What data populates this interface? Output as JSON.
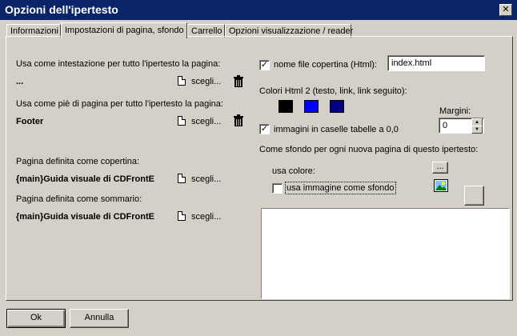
{
  "window": {
    "title": "Opzioni dell'ipertesto",
    "close_glyph": "✕"
  },
  "tabs": [
    {
      "label": "Informazioni",
      "active": false
    },
    {
      "label": "Impostazioni di pagina, sfondo",
      "active": true
    },
    {
      "label": "Carrello",
      "active": false
    },
    {
      "label": "Opzioni visualizzazione / reader",
      "active": false
    }
  ],
  "left": {
    "header_label": "Usa come intestazione per tutto l'ipertesto la pagina:",
    "header_value": "...",
    "footer_label": "Usa come piè di pagina per tutto l'ipertesto la pagina:",
    "footer_value": "Footer",
    "cover_label": "Pagina definita come copertina:",
    "cover_value": "{main}Guida visuale di CDFrontE",
    "summary_label": "Pagina definita come sommario:",
    "summary_value": "{main}Guida visuale di CDFrontE",
    "choose_label": "scegli..."
  },
  "right": {
    "cover_filename_label": "nome file copertina (Html):",
    "cover_filename_checked": true,
    "cover_filename_value": "index.html",
    "colors_label": "Colori Html 2 (testo, link, link seguito):",
    "colors": [
      "#000000",
      "#0000ff",
      "#000080"
    ],
    "margins_label": "Margini:",
    "margins_value": "0",
    "images_label": "immagini in caselle tabelle a 0,0",
    "images_checked": true,
    "background_label": "Come sfondo per ogni nuova pagina di questo ipertesto:",
    "use_color_label": "usa colore:",
    "color_button_label": "...",
    "use_image_label": "usa immagine come sfondo",
    "use_image_checked": false
  },
  "footer": {
    "ok_label": "Ok",
    "cancel_label": "Annulla"
  },
  "check_glyph": "✓"
}
